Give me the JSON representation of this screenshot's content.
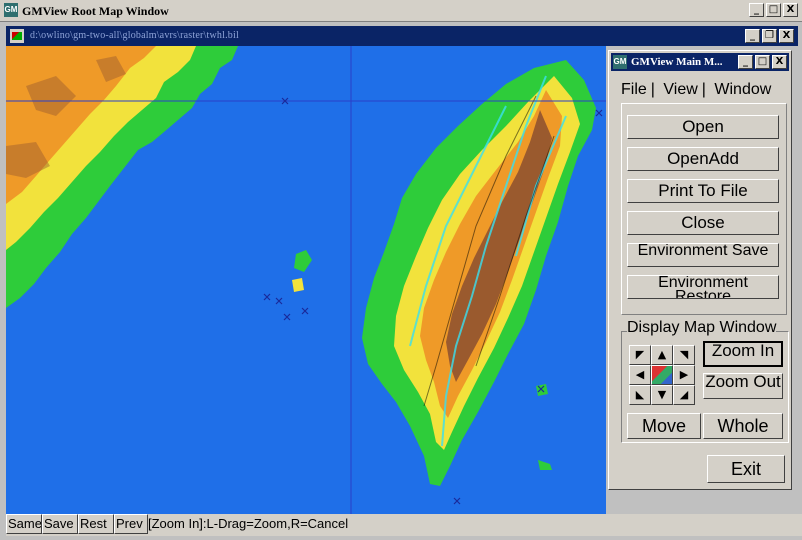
{
  "root_window": {
    "title": "GMView Root Map Window",
    "icon_text": "GM",
    "controls": [
      "_",
      "□",
      "X"
    ]
  },
  "map_window": {
    "title": "d:\\owlino\\gm-two-all\\globalm\\avrs\\raster\\twhl.bil",
    "controls": [
      "_",
      "❐",
      "X"
    ]
  },
  "status_bar": {
    "buttons": [
      "Same",
      "Save",
      "Rest",
      "Prev"
    ],
    "message": "[Zoom In]:L-Drag=Zoom,R=Cancel"
  },
  "main_panel": {
    "title": "GMView Main M...",
    "controls": [
      "_",
      "□",
      "X"
    ],
    "menu": [
      "File",
      "View",
      "Window"
    ],
    "file_buttons": [
      "Open",
      "OpenAdd",
      "Print To File",
      "Close",
      "Environment Save",
      "Environment Restore"
    ],
    "display_group_label": "Display Map Window",
    "arrows": [
      "◤",
      "▲",
      "◥",
      "◀",
      "map-center",
      "▶",
      "◣",
      "▼",
      "◢"
    ],
    "zoom_in_label": "Zoom In",
    "zoom_out_label": "Zoom Out",
    "move_label": "Move",
    "whole_label": "Whole",
    "exit_label": "Exit"
  },
  "colors": {
    "sea": "#1f6fe8",
    "lowland_green": "#2ecc3a",
    "upland_yellow": "#f2e23c",
    "highland_orange": "#ef9a28",
    "mountain_brown": "#9a5a2e",
    "river_cyan": "#38e0f0",
    "title_active": "#0a2466"
  }
}
